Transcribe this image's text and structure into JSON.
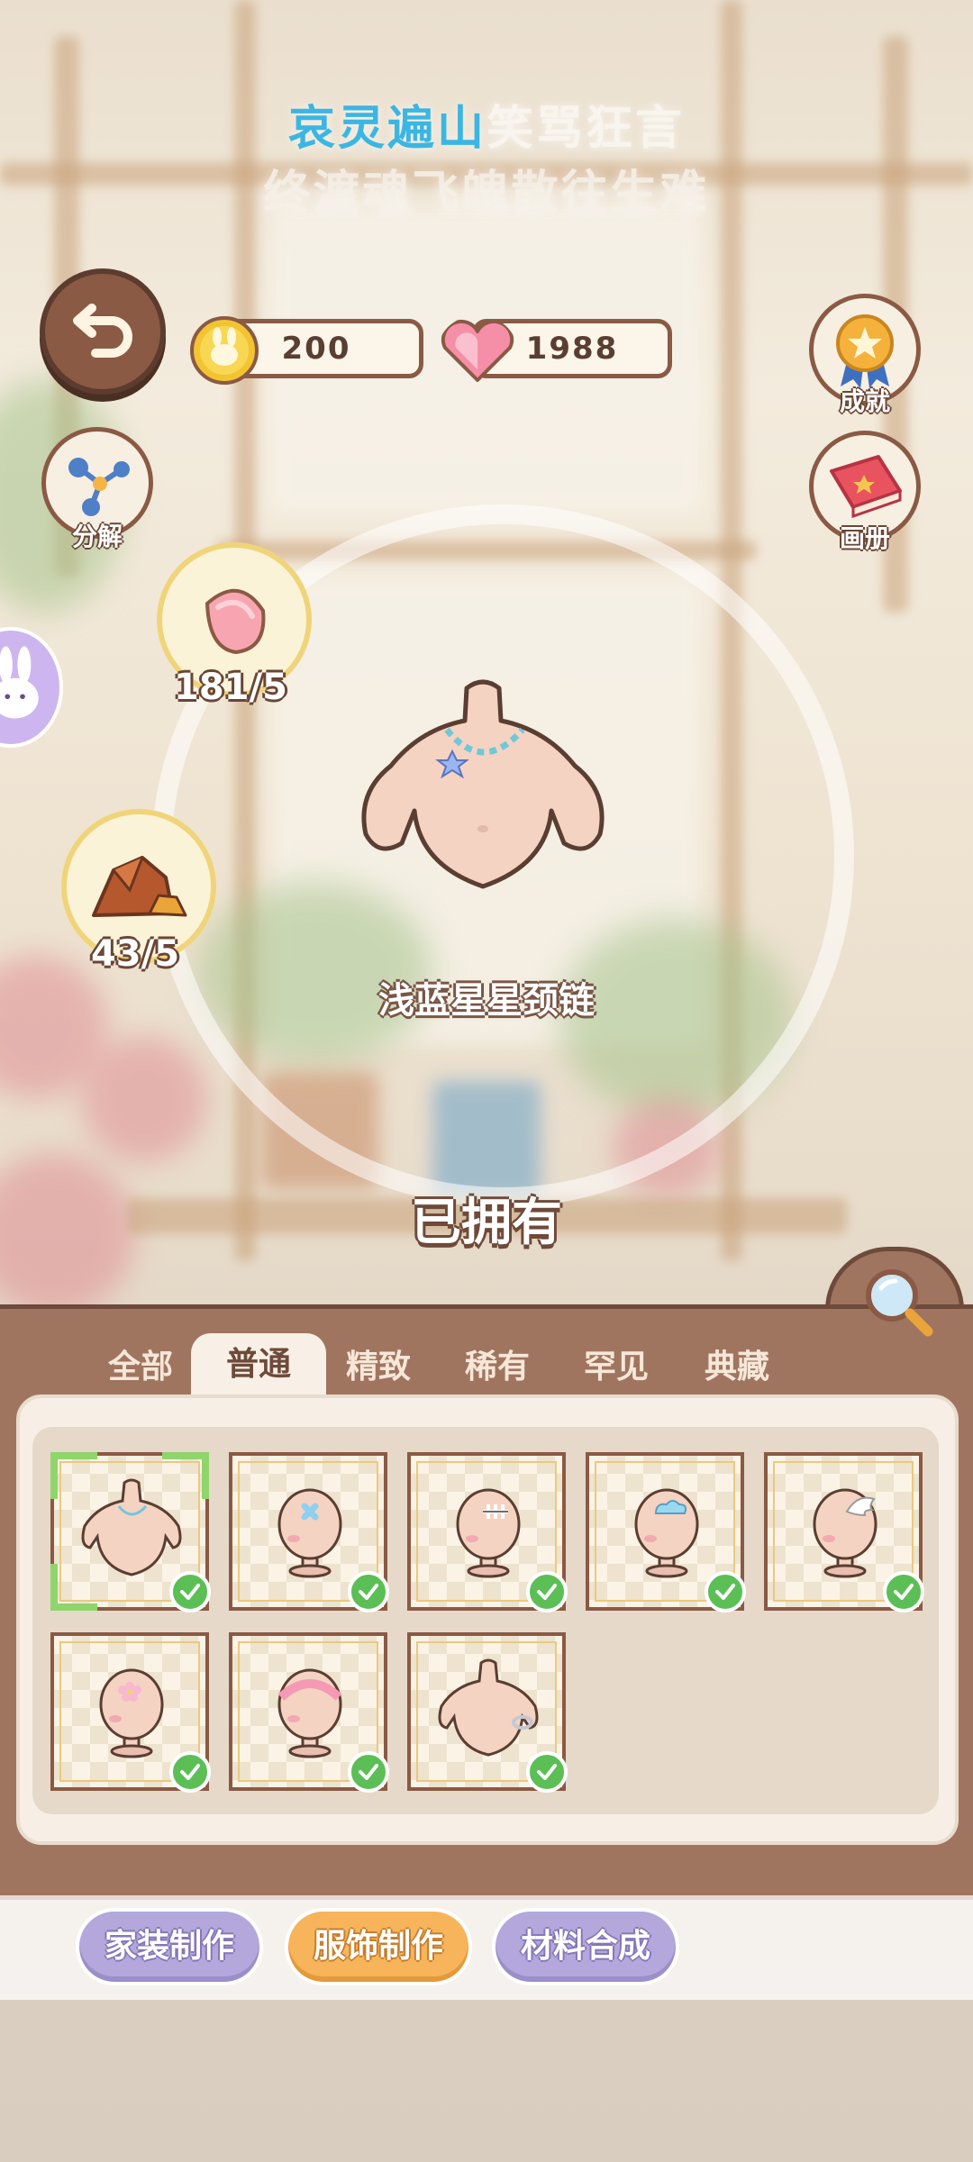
{
  "header": {
    "line1_highlight": "哀灵遍山",
    "line1_rest": "笑骂狂言",
    "line2": "终渡魂飞魄散往生难"
  },
  "currency": {
    "coins": "200",
    "hearts": "1988"
  },
  "side_buttons": {
    "decompose": "分解",
    "achievement": "成就",
    "album": "画册"
  },
  "materials": [
    {
      "icon": "petal-icon",
      "count": "181/5"
    },
    {
      "icon": "copper-ore-icon",
      "count": "43/5"
    }
  ],
  "preview": {
    "item_name": "浅蓝星星颈链",
    "status": "已拥有"
  },
  "tabs": [
    "全部",
    "普通",
    "精致",
    "稀有",
    "罕见",
    "典藏"
  ],
  "active_tab": "普通",
  "inventory": [
    {
      "name": "necklace-item",
      "owned": true,
      "selected": true
    },
    {
      "name": "blue-hairclip-item",
      "owned": true
    },
    {
      "name": "fishbone-hairclip-item",
      "owned": true
    },
    {
      "name": "cloud-hairclip-item",
      "owned": true
    },
    {
      "name": "wing-hairclip-item",
      "owned": true
    },
    {
      "name": "flower-hairclip-item",
      "owned": true
    },
    {
      "name": "pink-headband-item",
      "owned": true
    },
    {
      "name": "silver-bracelet-item",
      "owned": true
    }
  ],
  "bottom_actions": {
    "home_craft": "家装制作",
    "clothing_craft": "服饰制作",
    "material_synth": "材料合成"
  },
  "colors": {
    "panel": "#a07560",
    "accent_orange": "#f7b45a",
    "accent_purple": "#b3a7dc",
    "check_green": "#5bbf55",
    "highlight_blue": "#3bb6e3"
  }
}
